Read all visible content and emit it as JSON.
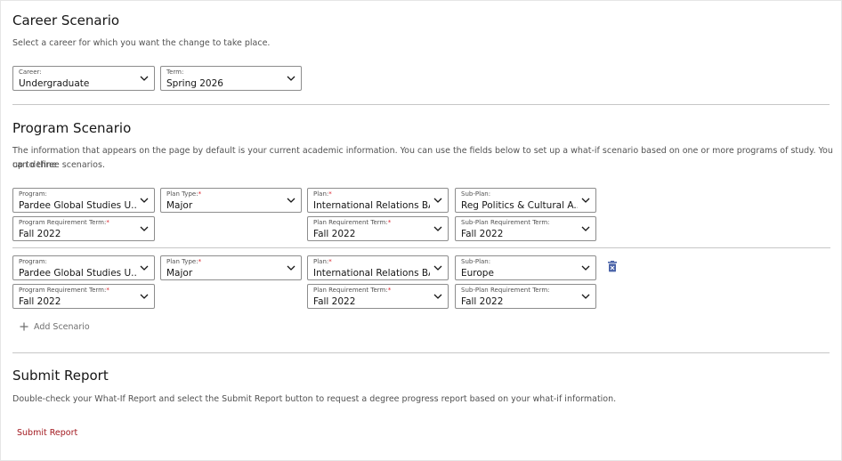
{
  "career": {
    "title": "Career Scenario",
    "description": "Select a career for which you want the change to take place.",
    "career_label": "Career:",
    "career_value": "Undergraduate",
    "term_label": "Term:",
    "term_value": "Spring 2026"
  },
  "program": {
    "title": "Program Scenario",
    "description_line1": "The information that appears on the page by default is your current academic information. You can use the fields below to set up a what-if scenario based on one or more programs of study. You can define",
    "description_line2": "up to three scenarios.",
    "scenarios": [
      {
        "program_label": "Program:",
        "program_value": "Pardee Global Studies U...",
        "plan_type_label": "Plan Type:",
        "plan_type_value": "Major",
        "plan_label": "Plan:",
        "plan_value": "International Relations BA",
        "subplan_label": "Sub-Plan:",
        "subplan_value": "Reg Politics & Cultural A...",
        "prog_req_term_label": "Program Requirement Term:",
        "prog_req_term_value": "Fall 2022",
        "plan_req_term_label": "Plan Requirement Term:",
        "plan_req_term_value": "Fall 2022",
        "subplan_req_term_label": "Sub-Plan Requirement Term:",
        "subplan_req_term_value": "Fall 2022"
      },
      {
        "program_label": "Program:",
        "program_value": "Pardee Global Studies U...",
        "plan_type_label": "Plan Type:",
        "plan_type_value": "Major",
        "plan_label": "Plan:",
        "plan_value": "International Relations BA",
        "subplan_label": "Sub-Plan:",
        "subplan_value": "Europe",
        "prog_req_term_label": "Program Requirement Term:",
        "prog_req_term_value": "Fall 2022",
        "plan_req_term_label": "Plan Requirement Term:",
        "plan_req_term_value": "Fall 2022",
        "subplan_req_term_label": "Sub-Plan Requirement Term:",
        "subplan_req_term_value": "Fall 2022"
      }
    ],
    "add_scenario_label": "Add Scenario",
    "required_mark": "*"
  },
  "submit": {
    "title": "Submit Report",
    "description": "Double-check your What-If Report and select the Submit Report button to request a degree progress report based on your what-if information.",
    "button_label": "Submit Report"
  },
  "icons": {
    "chevron": "chevron-down-icon",
    "add": "plus-icon",
    "delete": "trash-icon"
  },
  "colors": {
    "required": "#da1e28",
    "submit_link": "#a2191f",
    "trash_icon": "#4a63a8"
  }
}
